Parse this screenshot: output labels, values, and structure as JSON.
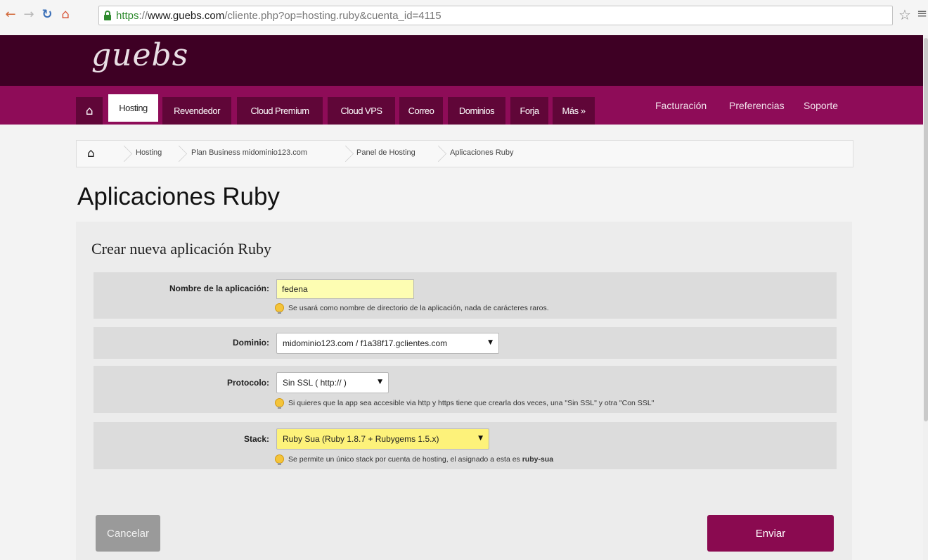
{
  "browser": {
    "url_scheme": "https",
    "url_sep": "://",
    "url_host": "www.guebs.com",
    "url_path": "/cliente.php?op=hosting.ruby&cuenta_id=4115"
  },
  "site": {
    "logo": "guebs"
  },
  "nav": {
    "tabs": [
      {
        "label": "Hosting"
      },
      {
        "label": "Revendedor"
      },
      {
        "label": "Cloud Premium"
      },
      {
        "label": "Cloud VPS"
      },
      {
        "label": "Correo"
      },
      {
        "label": "Dominios"
      },
      {
        "label": "Forja"
      },
      {
        "label": "Más »"
      }
    ],
    "right": [
      {
        "label": "Facturación"
      },
      {
        "label": "Preferencias"
      },
      {
        "label": "Soporte"
      }
    ]
  },
  "breadcrumb": {
    "items": [
      {
        "label": "Hosting"
      },
      {
        "label": "Plan Business midominio123.com"
      },
      {
        "label": "Panel de Hosting"
      },
      {
        "label": "Aplicaciones Ruby"
      }
    ]
  },
  "page": {
    "title": "Aplicaciones Ruby"
  },
  "form": {
    "title": "Crear nueva aplicación Ruby",
    "name_label": "Nombre de la aplicación:",
    "name_value": "fedena",
    "name_hint": "Se usará como nombre de directorio de la aplicación, nada de carácteres raros.",
    "domain_label": "Dominio:",
    "domain_value": "midominio123.com / f1a38f17.gclientes.com",
    "protocol_label": "Protocolo:",
    "protocol_value": "Sin SSL ( http:// )",
    "protocol_hint": "Si quieres que la app sea accesible via http y https tiene que crearla dos veces, una \"Sin SSL\" y otra \"Con SSL\"",
    "stack_label": "Stack:",
    "stack_value": "Ruby Sua (Ruby 1.8.7 + Rubygems 1.5.x)",
    "stack_hint": "Se permite un único stack por cuenta de hosting, el asignado a esta es",
    "stack_hint_bold": "ruby-sua",
    "cancel_label": "Cancelar",
    "submit_label": "Enviar"
  },
  "colors": {
    "header_dark": "#3e0024",
    "nav_magenta": "#8e0c58",
    "tab_dark": "#600638",
    "accent_button": "#8a0a50"
  }
}
